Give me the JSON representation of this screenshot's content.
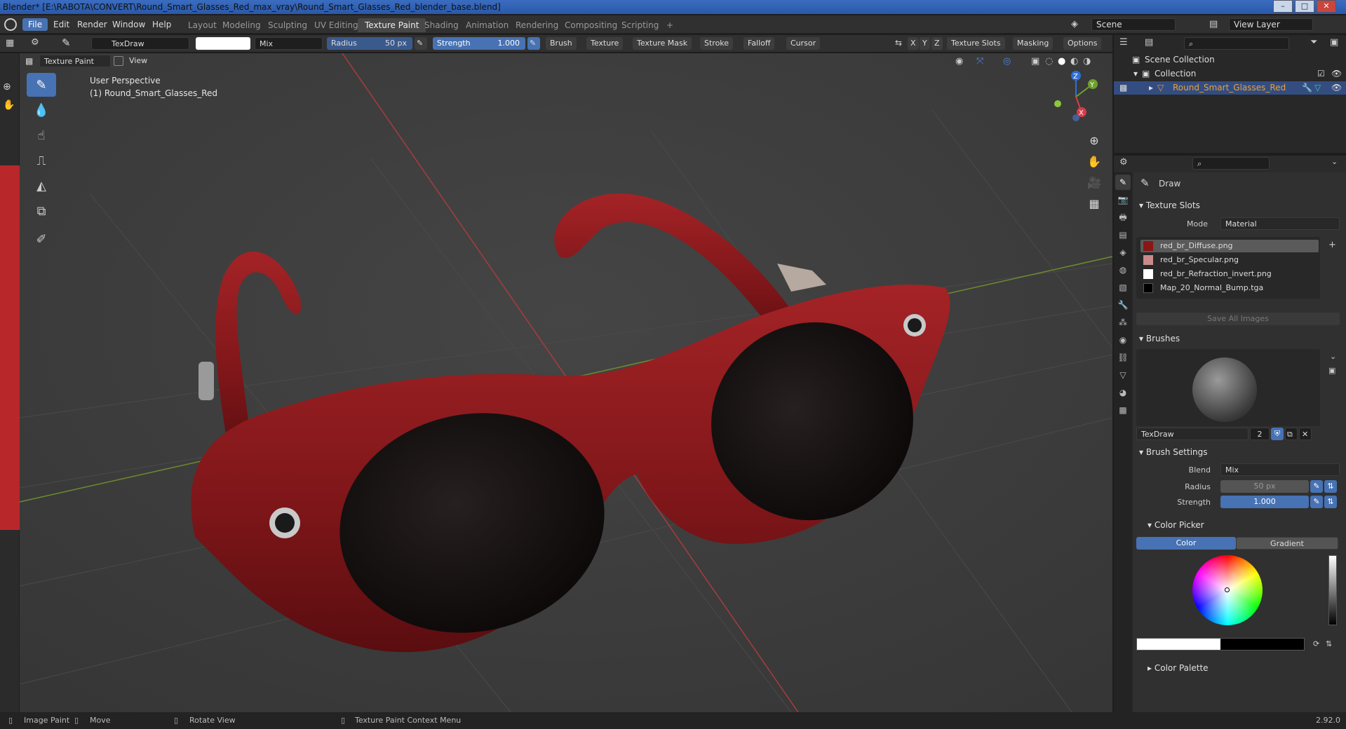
{
  "window": {
    "title": "Blender* [E:\\RABOTA\\CONVERT\\Round_Smart_Glasses_Red_max_vray\\Round_Smart_Glasses_Red_blender_base.blend]",
    "minimize": "–",
    "maximize": "□",
    "close": "✕"
  },
  "menus": [
    "File",
    "Edit",
    "Render",
    "Window",
    "Help"
  ],
  "workspaces": [
    "Layout",
    "Modeling",
    "Sculpting",
    "UV Editing",
    "Texture Paint",
    "Shading",
    "Animation",
    "Rendering",
    "Compositing",
    "Scripting"
  ],
  "workspace_add": "+",
  "scene": {
    "scene_name": "Scene",
    "view_layer": "View Layer"
  },
  "tool_header": {
    "brush_name": "TexDraw",
    "blend": "Mix",
    "radius_label": "Radius",
    "radius_value": "50 px",
    "strength_label": "Strength",
    "strength_value": "1.000",
    "menus": [
      "Brush",
      "Texture",
      "Texture Mask",
      "Stroke",
      "Falloff",
      "Cursor"
    ],
    "right_menus": [
      "Texture Slots",
      "Masking",
      "Options"
    ],
    "axes": [
      "X",
      "Y",
      "Z"
    ]
  },
  "mode_header": {
    "mode": "Texture Paint",
    "view": "View"
  },
  "viewport": {
    "perspective": "User Perspective",
    "object_label": "(1) Round_Smart_Glasses_Red",
    "gizmo_axes": [
      "X",
      "Y",
      "Z"
    ]
  },
  "outliner": {
    "scene_collection": "Scene Collection",
    "collection": "Collection",
    "object": "Round_Smart_Glasses_Red"
  },
  "properties": {
    "tool_name": "Draw",
    "texture_slots_title": "Texture Slots",
    "mode_label": "Mode",
    "mode_value": "Material",
    "slots": [
      {
        "name": "red_br_Diffuse.png",
        "color": "#8a1515"
      },
      {
        "name": "red_br_Specular.png",
        "color": "#c98a8a"
      },
      {
        "name": "red_br_Refraction_invert.png",
        "color": "#ffffff"
      },
      {
        "name": "Map_20_Normal_Bump.tga",
        "color": "#000000"
      }
    ],
    "save_all": "Save All Images",
    "brushes_title": "Brushes",
    "brush_name": "TexDraw",
    "brush_users": "2",
    "brush_settings_title": "Brush Settings",
    "blend_label": "Blend",
    "blend_value": "Mix",
    "radius_label": "Radius",
    "radius_value": "50 px",
    "strength_label": "Strength",
    "strength_value": "1.000",
    "color_picker_title": "Color Picker",
    "color_tab": "Color",
    "gradient_tab": "Gradient",
    "color_palette_title": "Color Palette"
  },
  "statusbar": {
    "image_paint": "Image Paint",
    "move": "Move",
    "rotate": "Rotate View",
    "context": "Texture Paint Context Menu",
    "version": "2.92.0"
  },
  "colors": {
    "accent": "#4772b3",
    "glasses_red": "#8e1a1d",
    "lens": "#1a1212"
  }
}
